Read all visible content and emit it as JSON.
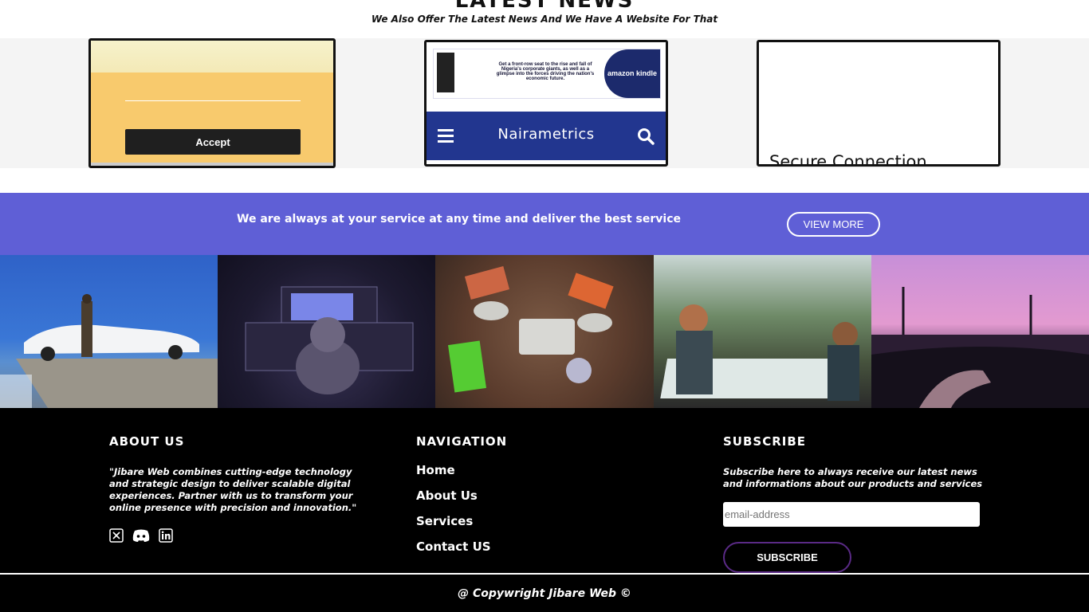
{
  "latest_news": {
    "title": "LATEST NEWS",
    "subtitle": "We Also Offer The Latest News And We Have A Website For That"
  },
  "cards": {
    "cookie_accept_label": "Accept",
    "ad_text": "Get a front-row seat to the rise and fall of Nigeria's corporate giants, as well as a glimpse into the forces driving the nation's economic future.",
    "ad_badge": "amazon kindle",
    "nairametrics_brand": "Nairametrics",
    "secure_connection": "Secure Connection"
  },
  "banner": {
    "message": "We are always at your service at any time and deliver the best service",
    "button": "VIEW MORE",
    "color": "#5f5fd6"
  },
  "footer": {
    "about_title": "ABOUT US",
    "about_text": "\"Jibare Web combines cutting-edge technology and strategic design to deliver scalable digital experiences. Partner with us to transform your online presence with precision and innovation.\"",
    "nav_title": "NAVIGATION",
    "nav_links": [
      "Home",
      "About Us",
      "Services",
      "Contact US"
    ],
    "subscribe_title": "SUBSCRIBE",
    "subscribe_text": "Subscribe here to always receive our latest news and informations about our products and services",
    "email_placeholder": "email-address",
    "subscribe_button": "SUBSCRIBE",
    "copyright": "@ Copywright Jibare Web ©",
    "social_icons": [
      "x-icon",
      "discord-icon",
      "linkedin-icon"
    ]
  }
}
